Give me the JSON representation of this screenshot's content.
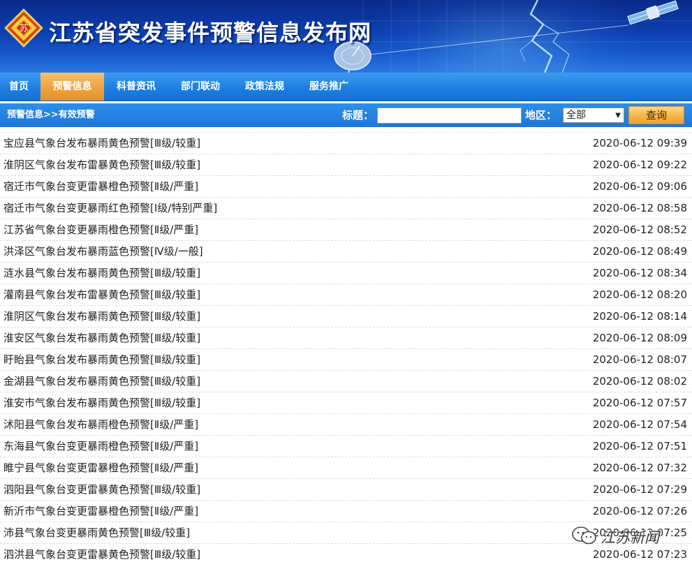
{
  "header": {
    "site_title": "江苏省突发事件预警信息发布网",
    "logo_text": "苏"
  },
  "nav": {
    "items": [
      {
        "label": "首页"
      },
      {
        "label": "预警信息"
      },
      {
        "label": "科普资讯"
      },
      {
        "label": "部门联动"
      },
      {
        "label": "政策法规"
      },
      {
        "label": "服务推广"
      }
    ],
    "active_index": 1
  },
  "subbar": {
    "breadcrumb": "预警信息>>有效预警",
    "title_label": "标题：",
    "title_value": "",
    "region_label": "地区：",
    "region_value": "全部",
    "query_label": "查询"
  },
  "warnings": [
    {
      "title": "宝应县气象台发布暴雨黄色预警[Ⅲ级/较重]",
      "time": "2020-06-12 09:39"
    },
    {
      "title": "淮阴区气象台发布雷暴黄色预警[Ⅲ级/较重]",
      "time": "2020-06-12 09:22"
    },
    {
      "title": "宿迁市气象台变更雷暴橙色预警[Ⅱ级/严重]",
      "time": "2020-06-12 09:06"
    },
    {
      "title": "宿迁市气象台变更暴雨红色预警[Ⅰ级/特别严重]",
      "time": "2020-06-12 08:58"
    },
    {
      "title": "江苏省气象台变更暴雨橙色预警[Ⅱ级/严重]",
      "time": "2020-06-12 08:52"
    },
    {
      "title": "洪泽区气象台发布暴雨蓝色预警[Ⅳ级/一般]",
      "time": "2020-06-12 08:49"
    },
    {
      "title": "涟水县气象台发布暴雨黄色预警[Ⅲ级/较重]",
      "time": "2020-06-12 08:34"
    },
    {
      "title": "灌南县气象台发布雷暴黄色预警[Ⅲ级/较重]",
      "time": "2020-06-12 08:20"
    },
    {
      "title": "淮阴区气象台发布暴雨黄色预警[Ⅲ级/较重]",
      "time": "2020-06-12 08:14"
    },
    {
      "title": "淮安区气象台发布暴雨黄色预警[Ⅲ级/较重]",
      "time": "2020-06-12 08:09"
    },
    {
      "title": "盱眙县气象台发布暴雨黄色预警[Ⅲ级/较重]",
      "time": "2020-06-12 08:07"
    },
    {
      "title": "金湖县气象台发布暴雨黄色预警[Ⅲ级/较重]",
      "time": "2020-06-12 08:02"
    },
    {
      "title": "淮安市气象台发布暴雨黄色预警[Ⅲ级/较重]",
      "time": "2020-06-12 07:57"
    },
    {
      "title": "沭阳县气象台发布暴雨橙色预警[Ⅱ级/严重]",
      "time": "2020-06-12 07:54"
    },
    {
      "title": "东海县气象台变更暴雨橙色预警[Ⅱ级/严重]",
      "time": "2020-06-12 07:51"
    },
    {
      "title": "睢宁县气象台变更雷暴橙色预警[Ⅱ级/严重]",
      "time": "2020-06-12 07:32"
    },
    {
      "title": "泗阳县气象台变更雷暴黄色预警[Ⅲ级/较重]",
      "time": "2020-06-12 07:29"
    },
    {
      "title": "新沂市气象台变更雷暴橙色预警[Ⅱ级/严重]",
      "time": "2020-06-12 07:26"
    },
    {
      "title": "沛县气象台变更暴雨黄色预警[Ⅲ级/较重]",
      "time": "2020-06-12 07:25"
    },
    {
      "title": "泗洪县气象台变更雷暴黄色预警[Ⅲ级/较重]",
      "time": "2020-06-12 07:23"
    }
  ],
  "watermark": {
    "text": "江苏新闻"
  },
  "colors": {
    "nav_blue": "#1e7fe0",
    "active_orange": "#eda13c",
    "banner_blue": "#0c3fae",
    "query_button": "#f3b444"
  }
}
